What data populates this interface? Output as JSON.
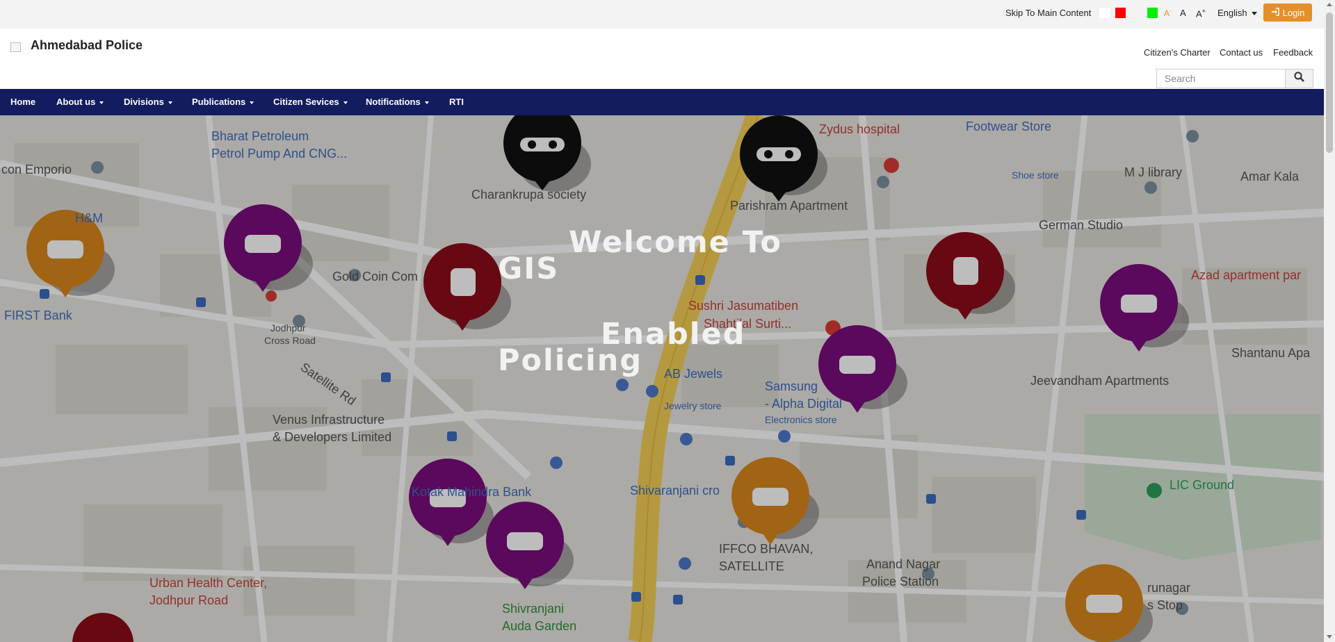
{
  "topbar": {
    "skip_link": "Skip To Main Content",
    "font_decrease": "A",
    "font_decrease_sup": "-",
    "font_normal": "A",
    "font_increase": "A",
    "font_increase_sup": "+",
    "language": "English",
    "login_label": "Login",
    "theme_colors": [
      "#ffffff",
      "#ff0000",
      "#00ee00"
    ]
  },
  "header": {
    "site_title": "Ahmedabad Police",
    "links": [
      "Citizen's Charter",
      "Contact us",
      "Feedback"
    ],
    "search_placeholder": "Search"
  },
  "nav": {
    "items": [
      {
        "label": "Home",
        "dropdown": false
      },
      {
        "label": "About us",
        "dropdown": true
      },
      {
        "label": "Divisions",
        "dropdown": true
      },
      {
        "label": "Publications",
        "dropdown": true
      },
      {
        "label": "Citizen Sevices",
        "dropdown": true
      },
      {
        "label": "Notifications",
        "dropdown": true
      },
      {
        "label": "RTI",
        "dropdown": false
      }
    ]
  },
  "hero": {
    "welcome_lines": [
      "Welcome To",
      "GIS",
      "Enabled",
      "Policing"
    ],
    "map_labels": [
      "Bharat Petroleum",
      "Petrol Pump And CNG...",
      "Zydus hospital",
      "Footwear Store",
      "con Emporio",
      "Charankrupa society",
      "Parishram Apartment",
      "M J library",
      "Amar Kala",
      "H&M",
      "German Studio",
      "Gold Coin Com",
      "Azad apartment par",
      "FIRST Bank",
      "Jodhpur",
      "Cross Road",
      "Sushri Jasumatiben",
      "Shahtilal Surti...",
      "Shantanu Apa",
      "Satellite Rd",
      "AB Jewels",
      "Jewelry store",
      "Samsung",
      "- Alpha Digital",
      "Electronics store",
      "Jeevandham Apartments",
      "Venus Infrastructure",
      "& Developers Limited",
      "Kotak Mahindra Bank",
      "Shivaranjani cro",
      "LIC Ground",
      "IFFCO BHAVAN,",
      "SATELLITE",
      "Anand Nagar",
      "Police Station",
      "Urban Health Center,",
      "Jodhpur Road",
      "Shivranjani",
      "Auda Garden",
      "runagar",
      "s Stop",
      "Shoe store"
    ]
  }
}
